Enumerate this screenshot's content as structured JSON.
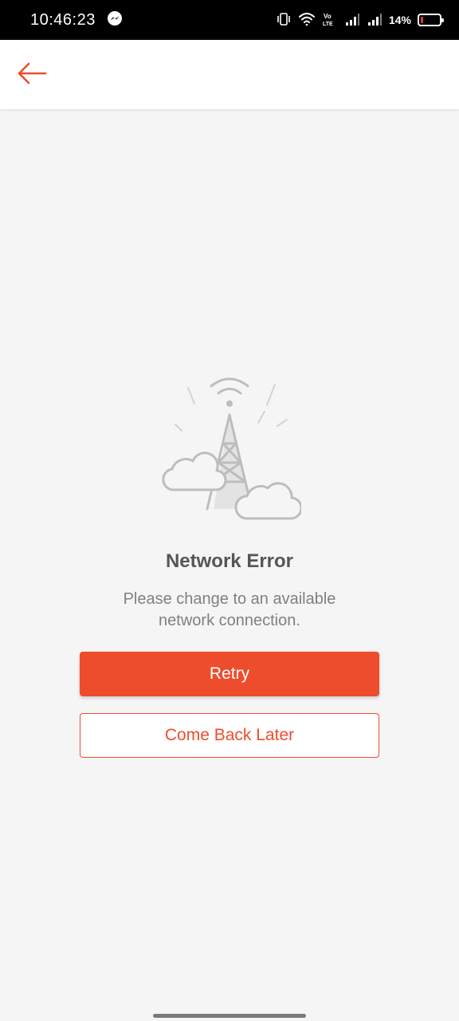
{
  "status_bar": {
    "time": "10:46:23",
    "battery_text": "14%",
    "battery_level_percent": 14,
    "icons": [
      "messenger-icon",
      "vibrate-icon",
      "wifi-icon",
      "volte-icon",
      "signal-icon",
      "signal-icon",
      "battery-icon"
    ]
  },
  "app_bar": {
    "back_icon": "arrow-left-icon",
    "accent_color": "#ee4d2d"
  },
  "error": {
    "illustration": "network-tower-icon",
    "title": "Network Error",
    "message": "Please change to an available network connection."
  },
  "buttons": {
    "retry_label": "Retry",
    "later_label": "Come Back Later"
  }
}
